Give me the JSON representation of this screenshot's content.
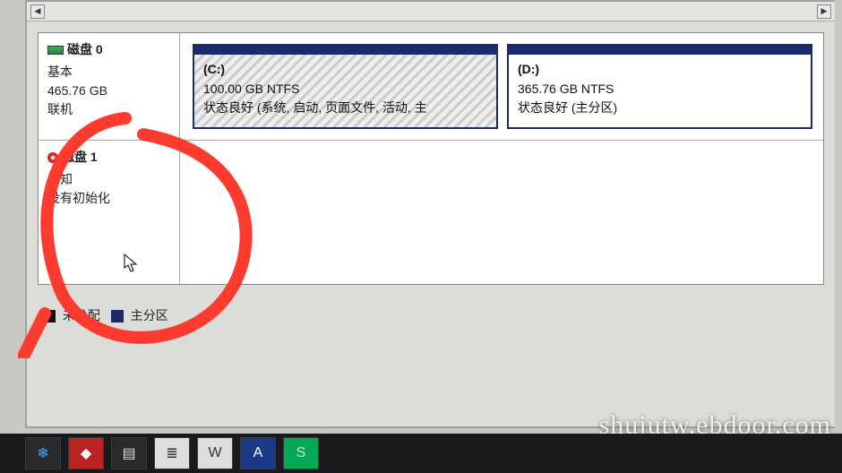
{
  "disk0": {
    "title": "磁盘 0",
    "type": "基本",
    "size": "465.76 GB",
    "status": "联机",
    "partitions": [
      {
        "drive": "(C:)",
        "size": "100.00 GB NTFS",
        "status": "状态良好 (系统, 启动, 页面文件, 活动, 主"
      },
      {
        "drive": "(D:)",
        "size": "365.76 GB NTFS",
        "status": "状态良好 (主分区)"
      }
    ]
  },
  "disk1": {
    "title": "磁盘 1",
    "type": "未知",
    "size": "",
    "status": "没有初始化"
  },
  "legend": {
    "unalloc": "未分配",
    "primary": "主分区"
  },
  "watermark": "shujutw.ebdoor.com"
}
